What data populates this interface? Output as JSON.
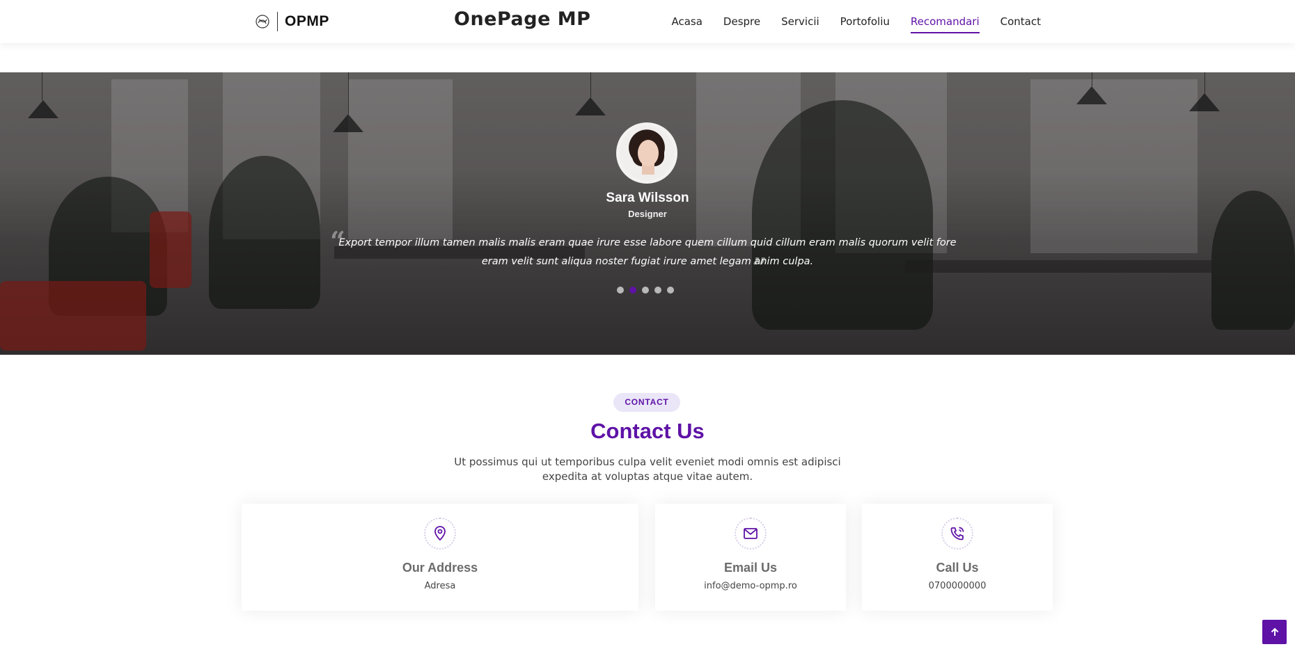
{
  "header": {
    "logo_text": "OPMP",
    "site_title": "OnePage MP",
    "nav": [
      {
        "label": "Acasa"
      },
      {
        "label": "Despre"
      },
      {
        "label": "Servicii"
      },
      {
        "label": "Portofoliu"
      },
      {
        "label": "Recomandari",
        "active": true
      },
      {
        "label": "Contact"
      }
    ]
  },
  "testimonial": {
    "name": "Sara Wilsson",
    "role": "Designer",
    "quote": "Export tempor illum tamen malis malis eram quae irure esse labore quem cillum quid cillum eram malis quorum velit fore eram velit sunt aliqua noster fugiat irure amet legam anim culpa.",
    "slide_count": 5,
    "active_slide": 2
  },
  "contact": {
    "badge": "CONTACT",
    "title": "Contact Us",
    "description": "Ut possimus qui ut temporibus culpa velit eveniet modi omnis est adipisci expedita at voluptas atque vitae autem.",
    "cards": [
      {
        "icon": "map-pin-icon",
        "title": "Our Address",
        "value": "Adresa"
      },
      {
        "icon": "envelope-icon",
        "title": "Email Us",
        "value": "info@demo-opmp.ro"
      },
      {
        "icon": "phone-icon",
        "title": "Call Us",
        "value": "0700000000"
      }
    ]
  },
  "colors": {
    "accent": "#5e12a6",
    "badge_bg": "#eae6f8"
  }
}
